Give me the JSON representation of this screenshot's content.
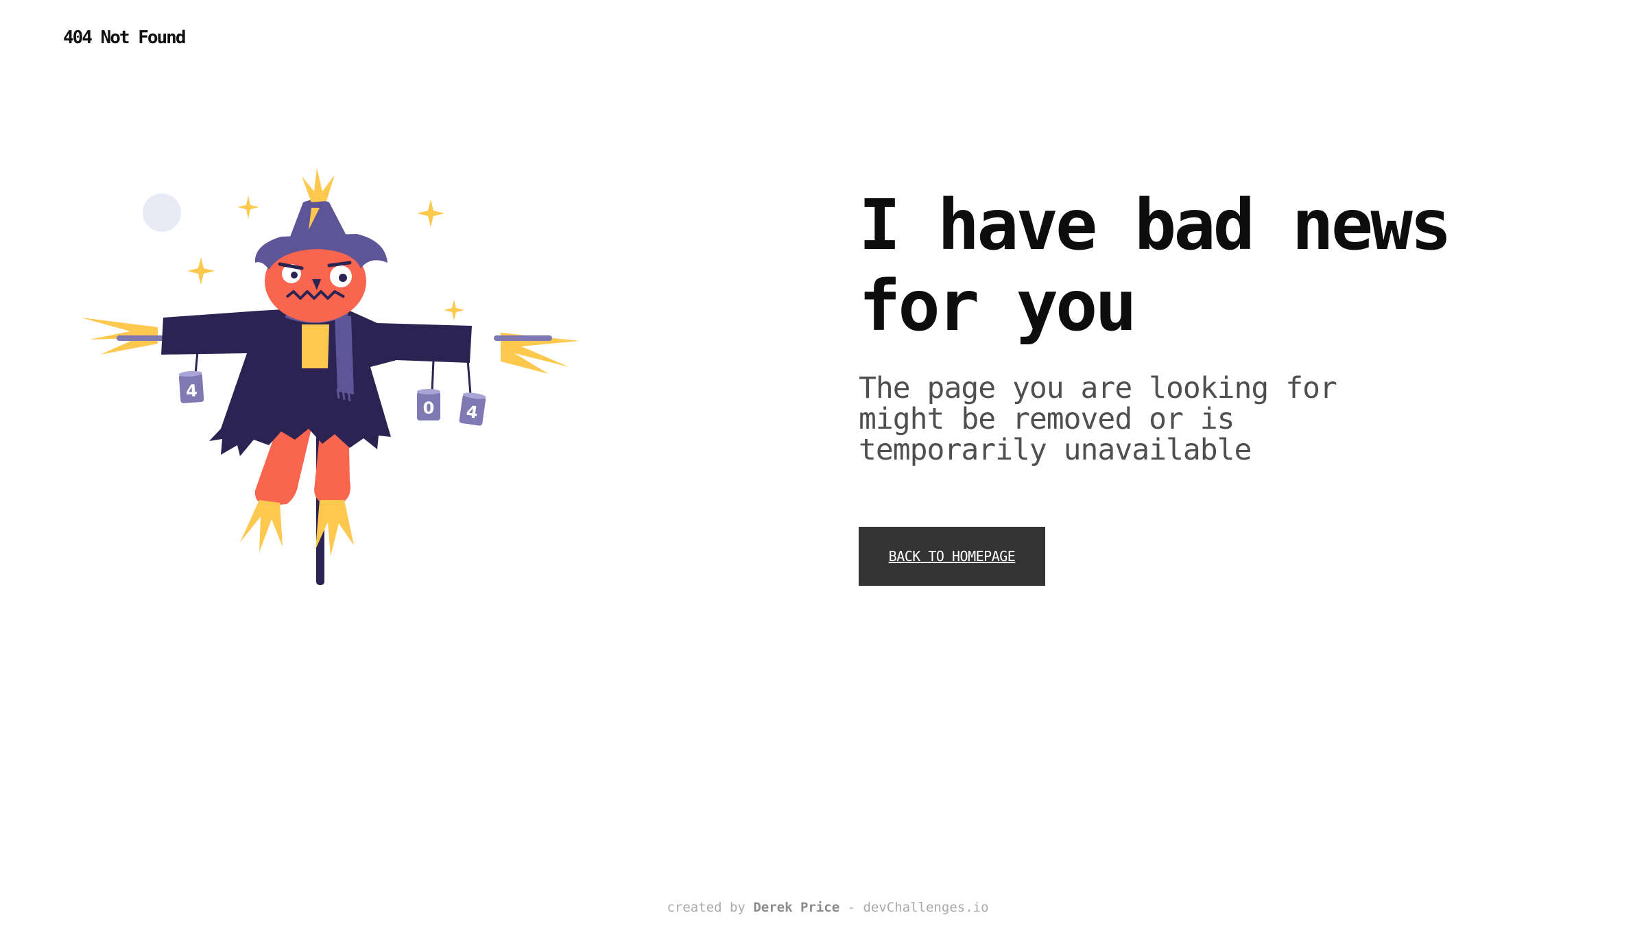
{
  "header": {
    "logo_text": "404 Not Found"
  },
  "main": {
    "headline_line1": "I have bad news",
    "headline_line2": "for you",
    "subtext_line1": "The page you are looking for",
    "subtext_line2": "might be removed or is",
    "subtext_line3": "temporarily unavailable",
    "button_label": "BACK TO HOMEPAGE"
  },
  "illustration": {
    "can_labels": [
      "4",
      "0",
      "4"
    ]
  },
  "footer": {
    "prefix": "created by ",
    "author": "Derek Price",
    "separator": " - ",
    "site": "devChallenges.io"
  },
  "colors": {
    "button_bg": "#333333",
    "hat": "#5d5597",
    "coat": "#2b2452",
    "face": "#f9654f",
    "straw": "#fcc84e",
    "moon": "#e8ebf6",
    "can": "#7e78b3"
  }
}
